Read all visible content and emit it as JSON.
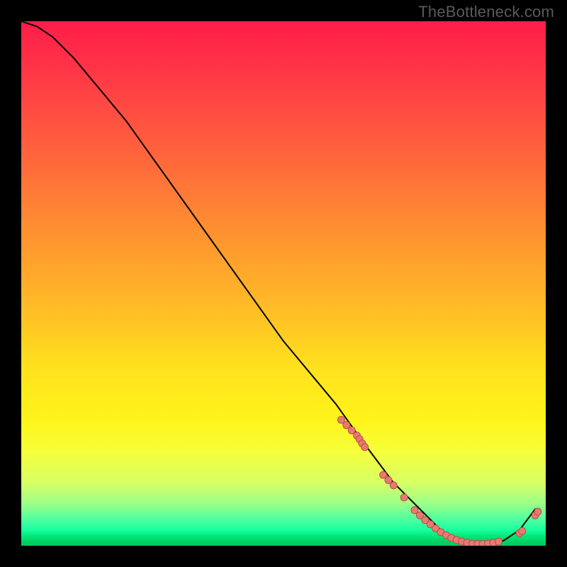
{
  "watermark": "TheBottleneck.com",
  "chart_data": {
    "type": "line",
    "title": "",
    "xlabel": "",
    "ylabel": "",
    "xlim": [
      0,
      100
    ],
    "ylim": [
      0,
      100
    ],
    "background": "rainbow-gradient red(top) → green(bottom)",
    "series": [
      {
        "name": "bottleneck-curve",
        "x": [
          0,
          3,
          6,
          10,
          15,
          20,
          25,
          30,
          35,
          40,
          45,
          50,
          55,
          60,
          65,
          68,
          71,
          74,
          77,
          80,
          83,
          86,
          89,
          92,
          95,
          98
        ],
        "y": [
          100,
          99,
          97,
          93,
          87,
          81,
          74,
          67,
          60,
          53,
          46,
          39,
          33,
          27,
          20,
          16,
          12,
          9,
          6,
          3,
          1,
          0,
          0,
          1,
          3,
          7
        ]
      }
    ],
    "highlight_points": {
      "name": "salmon-dots",
      "x": [
        61,
        62,
        63,
        64,
        64.5,
        65,
        65.5,
        69,
        70,
        71,
        73,
        75,
        76,
        77,
        78,
        79,
        80,
        81,
        82,
        83,
        84,
        85,
        86,
        87,
        88,
        89,
        90,
        91,
        95,
        95.5,
        98,
        98.5
      ],
      "y": [
        24,
        23,
        22,
        21,
        20.3,
        19.5,
        18.8,
        13.5,
        12.5,
        11.5,
        9.2,
        6.8,
        5.8,
        4.9,
        4.1,
        3.3,
        2.6,
        2.0,
        1.5,
        1.1,
        0.8,
        0.55,
        0.4,
        0.35,
        0.35,
        0.4,
        0.55,
        0.8,
        2.4,
        2.8,
        5.8,
        6.5
      ]
    }
  }
}
